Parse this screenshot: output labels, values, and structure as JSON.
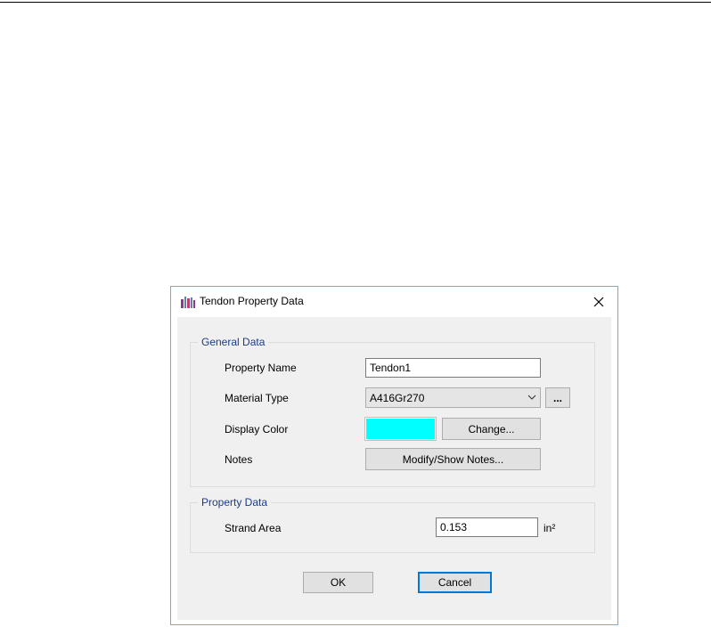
{
  "dialog": {
    "title": "Tendon Property Data",
    "close_glyph": "✕"
  },
  "general_data": {
    "legend": "General Data",
    "property_name_label": "Property Name",
    "property_name_value": "Tendon1",
    "material_type_label": "Material Type",
    "material_type_value": "A416Gr270",
    "material_browse_label": "...",
    "display_color_label": "Display Color",
    "display_color_value": "#00ffff",
    "change_button_label": "Change...",
    "notes_label": "Notes",
    "notes_button_label": "Modify/Show Notes..."
  },
  "property_data": {
    "legend": "Property Data",
    "strand_area_label": "Strand Area",
    "strand_area_value": "0.153",
    "strand_area_unit": "in²"
  },
  "buttons": {
    "ok_label": "OK",
    "cancel_label": "Cancel"
  },
  "colors": {
    "accent": "#0078d7",
    "legend_text": "#1a3c8a"
  },
  "icons": {
    "app": "tendon-app-icon",
    "close": "close-icon",
    "dropdown": "chevron-down-icon"
  }
}
